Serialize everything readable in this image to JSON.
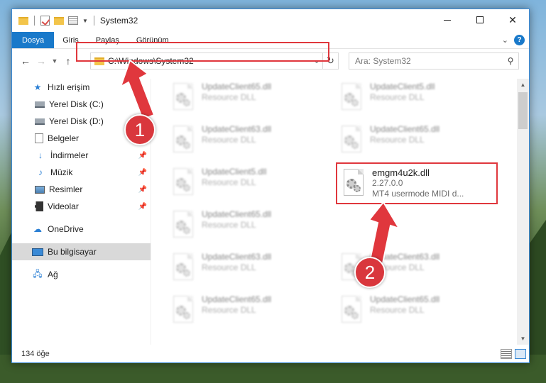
{
  "window": {
    "title": "System32",
    "ribbon_tabs": [
      "Dosya",
      "Giriş",
      "Paylaş",
      "Görünüm"
    ]
  },
  "address_bar": {
    "path": "C:\\Windows\\System32"
  },
  "search": {
    "placeholder": "Ara: System32"
  },
  "sidebar": {
    "items": [
      {
        "label": "Hızlı erişim",
        "icon": "star-icon"
      },
      {
        "label": "Yerel Disk (C:)",
        "icon": "drive-icon"
      },
      {
        "label": "Yerel Disk (D:)",
        "icon": "drive-icon"
      },
      {
        "label": "Belgeler",
        "icon": "document-icon"
      },
      {
        "label": "İndirmeler",
        "icon": "download-icon"
      },
      {
        "label": "Müzik",
        "icon": "music-icon"
      },
      {
        "label": "Resimler",
        "icon": "pictures-icon"
      },
      {
        "label": "Videolar",
        "icon": "videos-icon"
      },
      {
        "label": "OneDrive",
        "icon": "cloud-icon"
      },
      {
        "label": "Bu bilgisayar",
        "icon": "computer-icon"
      },
      {
        "label": "Ağ",
        "icon": "network-icon"
      }
    ]
  },
  "files": {
    "left": [
      {
        "name": "UpdateClient65.dll",
        "type": "Resource DLL"
      },
      {
        "name": "UpdateClient63.dll",
        "type": "Resource DLL"
      },
      {
        "name": "UpdateClient5.dll",
        "type": "Resource DLL"
      },
      {
        "name": "UpdateClient65.dll",
        "type": "Resource DLL"
      },
      {
        "name": "UpdateClient63.dll",
        "type": "Resource DLL"
      },
      {
        "name": "UpdateClient65.dll",
        "type": "Resource DLL"
      }
    ],
    "right": [
      {
        "name": "UpdateClient5.dll",
        "type": "Resource DLL"
      },
      {
        "name": "UpdateClient65.dll",
        "type": "Resource DLL"
      },
      {
        "name": "UpdateClient63.dll",
        "type": "Resource DLL"
      },
      {
        "name": "UpdateClient65.dll",
        "type": "Resource DLL"
      }
    ],
    "highlighted": {
      "name": "emgm4u2k.dll",
      "version": "2.27.0.0",
      "description": "MT4 usermode MIDI d..."
    }
  },
  "status": {
    "item_count": "134 öğe"
  },
  "annotations": {
    "marker1": "1",
    "marker2": "2",
    "color": "#e0373d"
  }
}
